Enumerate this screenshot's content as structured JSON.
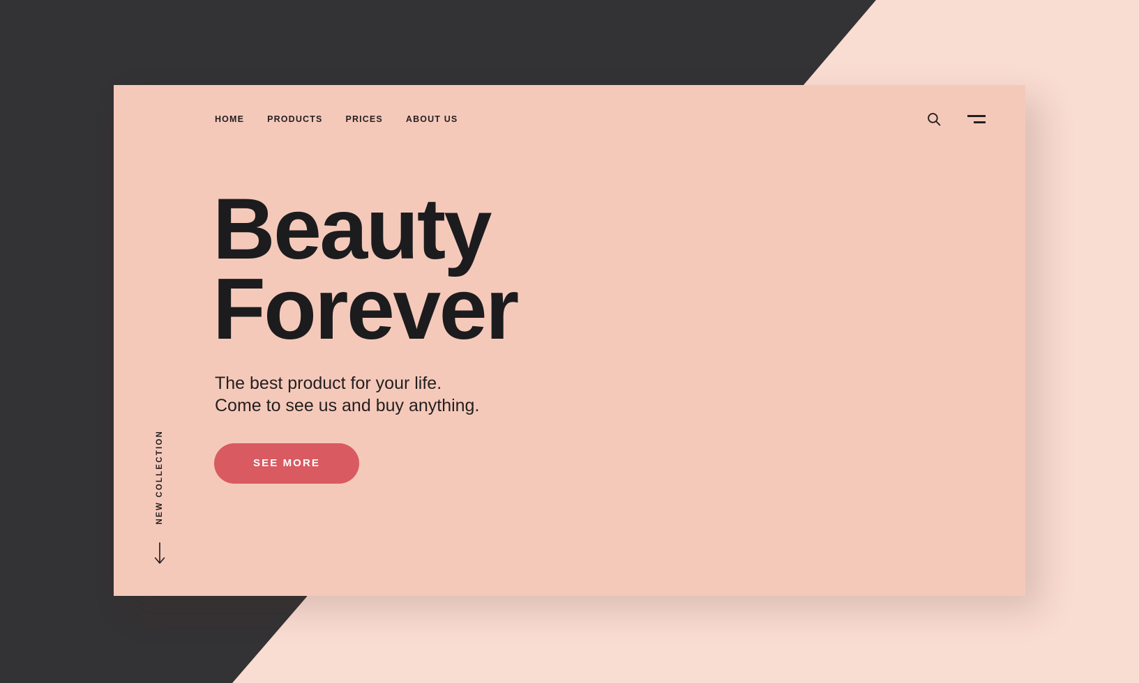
{
  "palette": {
    "background_outer": "#F9DCD2",
    "background_dark": "#333234",
    "card": "#F5C9BA",
    "text": "#231f20",
    "heading": "#1c1c1e",
    "accent_button": "#D95A61",
    "button_text": "#FFFFFF"
  },
  "nav": {
    "links": [
      {
        "label": "HOME"
      },
      {
        "label": "PRODUCTS"
      },
      {
        "label": "PRICES"
      },
      {
        "label": "ABOUT US"
      }
    ],
    "actions": {
      "search_icon": "search-icon",
      "menu_icon": "hamburger-menu-icon"
    }
  },
  "hero": {
    "headline_line1": "Beauty",
    "headline_line2": "Forever",
    "subcopy_line1": "The best product for your life.",
    "subcopy_line2": "Come to see us and buy anything.",
    "cta_label": "SEE MORE"
  },
  "rail": {
    "label": "NEW COLLECTION",
    "arrow_icon": "arrow-down-icon"
  }
}
